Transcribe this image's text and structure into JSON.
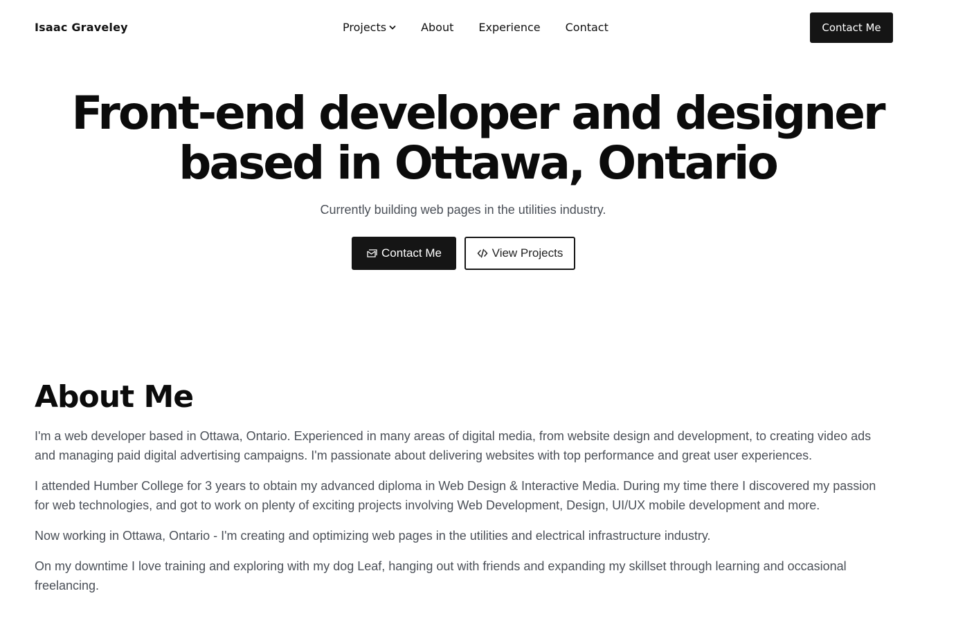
{
  "header": {
    "logo": "Isaac Graveley",
    "nav": [
      {
        "label": "Projects",
        "has_dropdown": true
      },
      {
        "label": "About"
      },
      {
        "label": "Experience"
      },
      {
        "label": "Contact"
      }
    ],
    "cta_label": "Contact Me"
  },
  "hero": {
    "title_line1": "Front-end developer and designer",
    "title_line2": "based in Ottawa, Ontario",
    "subtitle": "Currently building web pages in the utilities industry.",
    "primary_button": {
      "label": "Contact Me",
      "icon": "mail-icon"
    },
    "secondary_button": {
      "label": "View Projects",
      "icon": "code-icon"
    }
  },
  "about": {
    "title": "About Me",
    "paragraphs": [
      "I'm a web developer based in Ottawa, Ontario. Experienced in many areas of digital media, from website design and development, to creating video ads and managing paid digital advertising campaigns. I'm passionate about delivering websites with top performance and great user experiences.",
      "I attended Humber College for 3 years to obtain my advanced diploma in Web Design & Interactive Media. During my time there I discovered my passion for web technologies, and got to work on plenty of exciting projects involving Web Development, Design, UI/UX mobile development and more.",
      "Now working in Ottawa, Ontario - I'm creating and optimizing web pages in the utilities and electrical infrastructure industry.",
      "On my downtime I love training and exploring with my dog Leaf, hanging out with friends and expanding my skillset through learning and occasional freelancing."
    ]
  },
  "colors": {
    "primary_dark": "#151515",
    "text_body": "#4a4f57",
    "background": "#ffffff"
  }
}
